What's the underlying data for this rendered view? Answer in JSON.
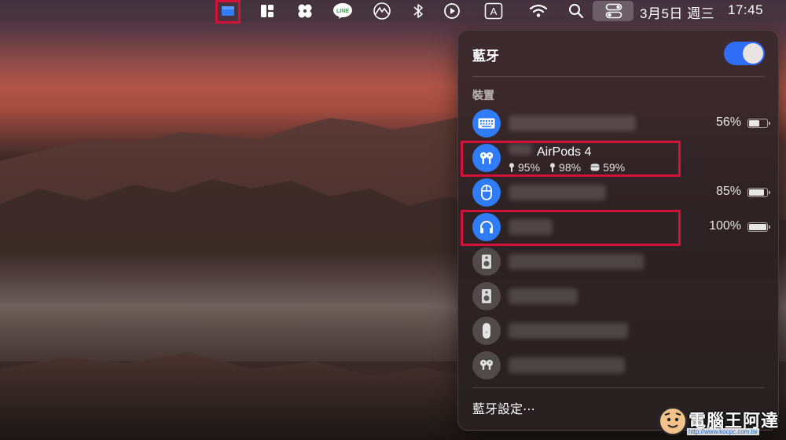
{
  "menubar": {
    "status_items": [
      {
        "name": "app-indicator-icon"
      },
      {
        "name": "split-view-icon"
      },
      {
        "name": "fan-icon"
      },
      {
        "name": "line-app-icon",
        "label": "LINE"
      },
      {
        "name": "mountain-app-icon"
      },
      {
        "name": "bluetooth-icon"
      },
      {
        "name": "play-icon"
      },
      {
        "name": "input-source-icon",
        "label": "A"
      },
      {
        "name": "wifi-icon"
      },
      {
        "name": "search-icon"
      },
      {
        "name": "control-center-icon"
      }
    ],
    "date": "3月5日 週三",
    "time": "17:45"
  },
  "panel": {
    "title": "藍牙",
    "toggle_on": true,
    "section_label": "裝置",
    "devices": [
      {
        "icon": "keyboard-icon",
        "connected": true,
        "percent": "56%",
        "battery_level": 0.56
      },
      {
        "icon": "airpods-icon",
        "connected": true,
        "name": "AirPods 4",
        "left": "95%",
        "right": "98%",
        "case": "59%"
      },
      {
        "icon": "mouse-icon",
        "connected": true,
        "percent": "85%",
        "battery_level": 0.85
      },
      {
        "icon": "headphones-icon",
        "connected": true,
        "percent": "100%",
        "battery_level": 1.0
      },
      {
        "icon": "speaker-icon",
        "connected": false
      },
      {
        "icon": "speaker-icon",
        "connected": false
      },
      {
        "icon": "magic-mouse-icon",
        "connected": false
      },
      {
        "icon": "airpods-pro-icon",
        "connected": false
      }
    ],
    "footer": "藍牙設定⋯"
  },
  "watermark": {
    "text": "電腦王阿達",
    "url": "http://www.kocpc.com.tw"
  },
  "colors": {
    "highlight_box": "#d2123a",
    "accent_blue": "#2f7cf6",
    "toggle_blue": "#2f6df6"
  }
}
